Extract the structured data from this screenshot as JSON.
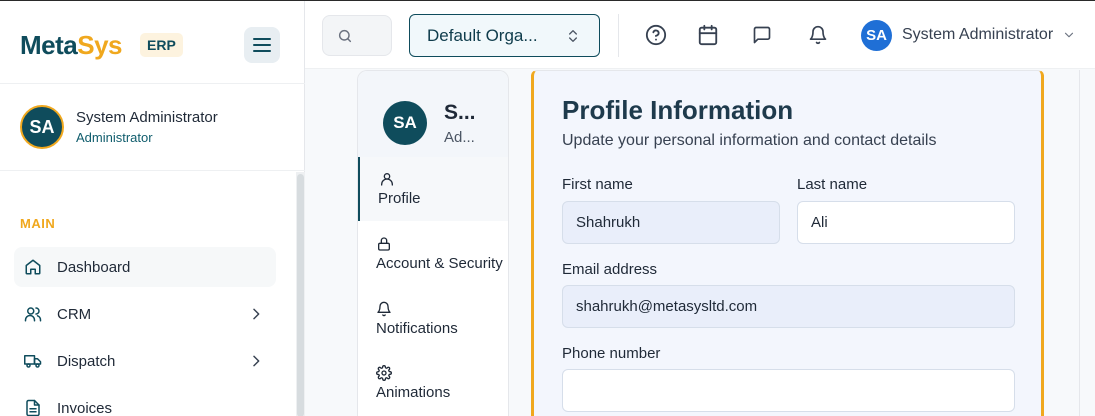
{
  "brand": {
    "name_part1": "Meta",
    "name_part2": "Sys",
    "badge": "ERP"
  },
  "sidebar": {
    "user": {
      "initials": "SA",
      "name": "System Administrator",
      "role": "Administrator"
    },
    "section_label": "MAIN",
    "items": [
      {
        "label": "Dashboard",
        "icon": "home-icon",
        "has_children": false
      },
      {
        "label": "CRM",
        "icon": "users-icon",
        "has_children": true
      },
      {
        "label": "Dispatch",
        "icon": "truck-icon",
        "has_children": true
      },
      {
        "label": "Invoices",
        "icon": "document-icon",
        "has_children": false
      }
    ]
  },
  "header": {
    "organization": "Default Orga...",
    "user": {
      "initials": "SA",
      "name": "System Administrator"
    },
    "icons": [
      "help-icon",
      "calendar-icon",
      "message-icon",
      "bell-icon"
    ]
  },
  "settings_nav": {
    "user": {
      "initials": "SA",
      "name": "S...",
      "role": "Ad..."
    },
    "items": [
      {
        "label": "Profile",
        "icon": "user-icon",
        "active": true
      },
      {
        "label": "Account & Security",
        "icon": "lock-icon",
        "active": false
      },
      {
        "label": "Notifications",
        "icon": "bell-icon",
        "active": false
      },
      {
        "label": "Animations",
        "icon": "gear-icon",
        "active": false
      }
    ]
  },
  "profile": {
    "title": "Profile Information",
    "subtitle": "Update your personal information and contact details",
    "first_name": {
      "label": "First name",
      "value": "Shahrukh"
    },
    "last_name": {
      "label": "Last name",
      "value": "Ali"
    },
    "email": {
      "label": "Email address",
      "value": "shahrukh@metasysltd.com"
    },
    "phone": {
      "label": "Phone number",
      "value": ""
    }
  },
  "colors": {
    "primary": "#0f4c5c",
    "accent": "#f0a81e",
    "avatar_blue": "#1f6fd6"
  }
}
